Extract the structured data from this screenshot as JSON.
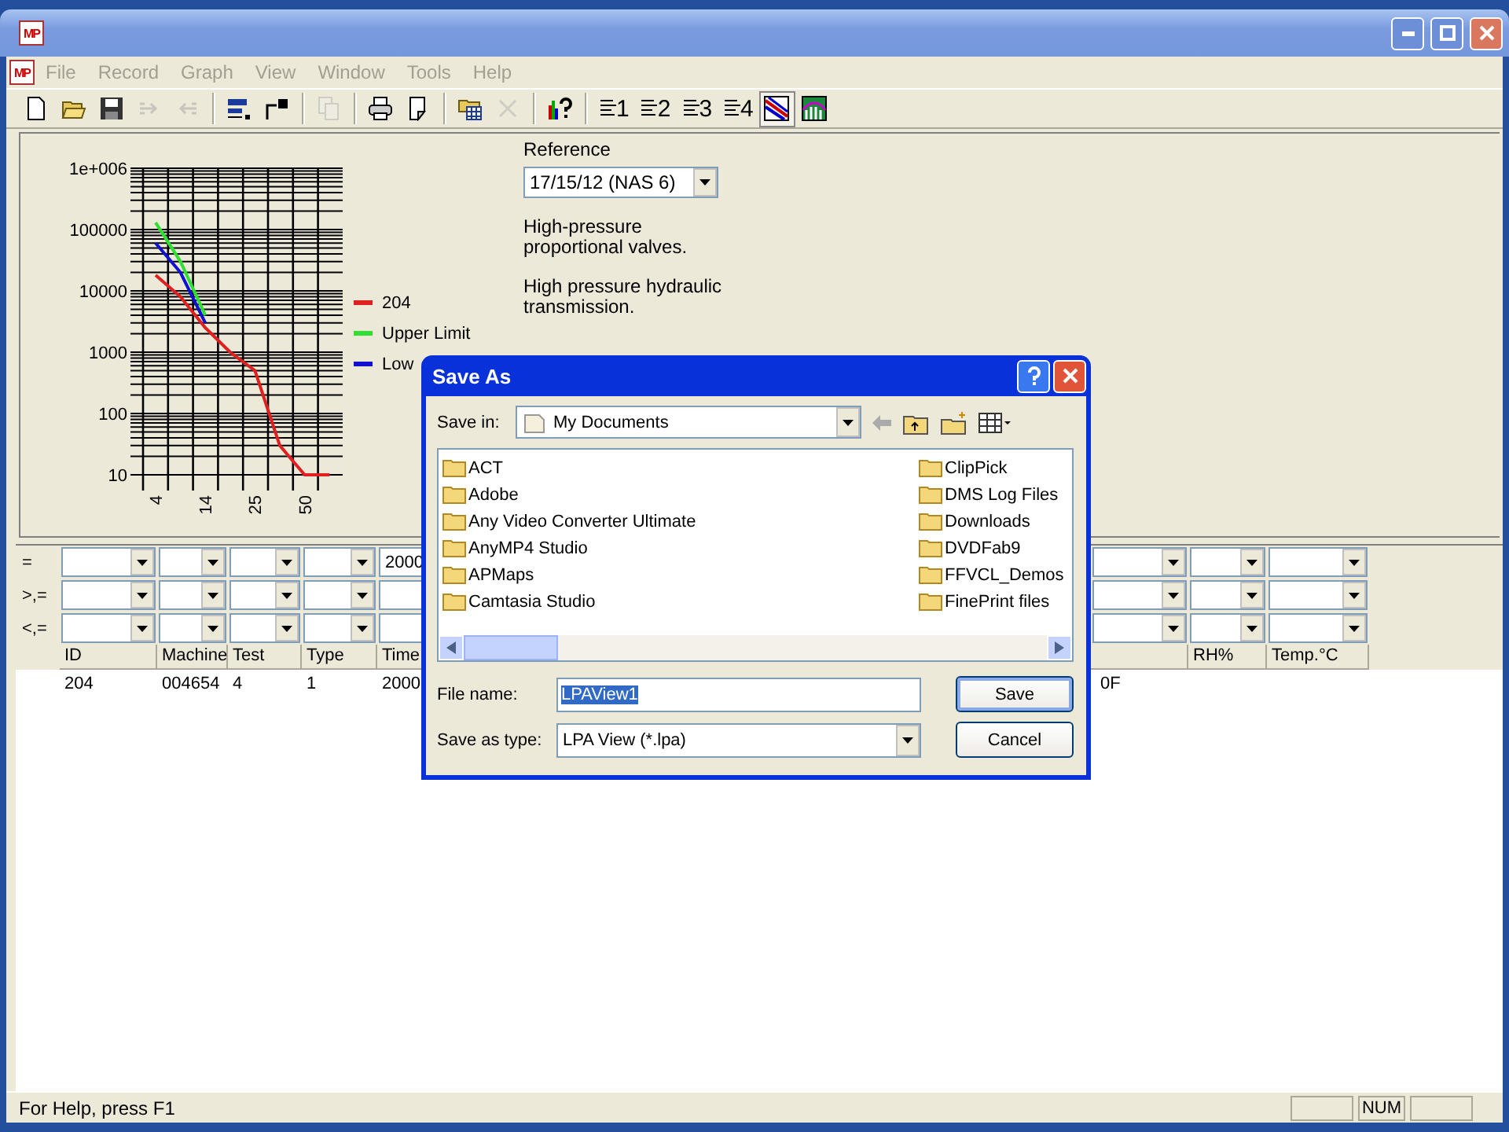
{
  "window": {
    "icon_text": "MP",
    "document_icon_text": "MP"
  },
  "menu": [
    {
      "label": "File",
      "disabled": true
    },
    {
      "label": "Record",
      "disabled": true
    },
    {
      "label": "Graph",
      "disabled": true
    },
    {
      "label": "View",
      "disabled": true
    },
    {
      "label": "Window",
      "disabled": true
    },
    {
      "label": "Tools",
      "disabled": true
    },
    {
      "label": "Help",
      "disabled": true
    }
  ],
  "toolbar": [
    {
      "kind": "new",
      "disabled": false
    },
    {
      "kind": "open",
      "disabled": false
    },
    {
      "kind": "save",
      "disabled": false
    },
    {
      "kind": "export",
      "disabled": true
    },
    {
      "kind": "import",
      "disabled": true
    },
    {
      "kind": "separator"
    },
    {
      "kind": "fields",
      "disabled": false
    },
    {
      "kind": "resize",
      "disabled": false
    },
    {
      "kind": "separator"
    },
    {
      "kind": "copy",
      "disabled": true
    },
    {
      "kind": "separator"
    },
    {
      "kind": "print",
      "disabled": false
    },
    {
      "kind": "preview",
      "disabled": false
    },
    {
      "kind": "separator"
    },
    {
      "kind": "database",
      "disabled": false
    },
    {
      "kind": "delete",
      "disabled": true
    },
    {
      "kind": "separator"
    },
    {
      "kind": "chart-help",
      "disabled": false
    },
    {
      "kind": "separator"
    },
    {
      "kind": "numbered",
      "label": "1",
      "disabled": false
    },
    {
      "kind": "numbered",
      "label": "2",
      "disabled": false
    },
    {
      "kind": "numbered",
      "label": "3",
      "disabled": false
    },
    {
      "kind": "numbered",
      "label": "4",
      "disabled": false
    },
    {
      "kind": "line-chart",
      "disabled": false,
      "selected": true
    },
    {
      "kind": "bar-chart",
      "disabled": false,
      "selected": false
    }
  ],
  "graph": {
    "y_labels": [
      "1e+006",
      "100000",
      "10000",
      "1000",
      "100",
      "10"
    ],
    "x_labels": [
      "4",
      "14",
      "25",
      "50"
    ],
    "legend": [
      {
        "label": "204",
        "color": "#e02020"
      },
      {
        "label": "Upper Limit",
        "color": "#30e030"
      },
      {
        "label": "Low",
        "color": "#1010d0"
      }
    ]
  },
  "reference": {
    "label": "Reference",
    "value": "17/15/12 (NAS 6)",
    "notes": [
      "High-pressure proportional valves.",
      "High pressure hydraulic transmission."
    ]
  },
  "filters": [
    {
      "operator": "=",
      "time_value": "2000"
    },
    {
      "operator": ">,="
    },
    {
      "operator": "<,="
    }
  ],
  "table": {
    "columns": [
      "ID",
      "Machine",
      "Test",
      "Type",
      "Time",
      null,
      "RH%",
      "Temp.°C"
    ],
    "rows": [
      {
        "cells": [
          "204",
          "004654",
          "4",
          "1",
          "2000",
          "0F"
        ]
      }
    ]
  },
  "dialog": {
    "title": "Save As",
    "save_in_label": "Save in:",
    "save_in": "My Documents",
    "folders": [
      "ACT",
      "Adobe",
      "Any Video Converter Ultimate",
      "AnyMP4 Studio",
      "APMaps",
      "Camtasia Studio",
      "ClipPick",
      "DMS Log Files",
      "Downloads",
      "DVDFab9",
      "FFVCL_Demos",
      "FinePrint files"
    ],
    "file_name_label": "File name:",
    "file_name": "LPAView1",
    "type_label": "Save as type:",
    "type": "LPA View  (*.lpa)",
    "buttons": [
      "Save",
      "Cancel"
    ]
  },
  "status_bar": {
    "text": "For Help, press F1",
    "indicator": "NUM"
  }
}
